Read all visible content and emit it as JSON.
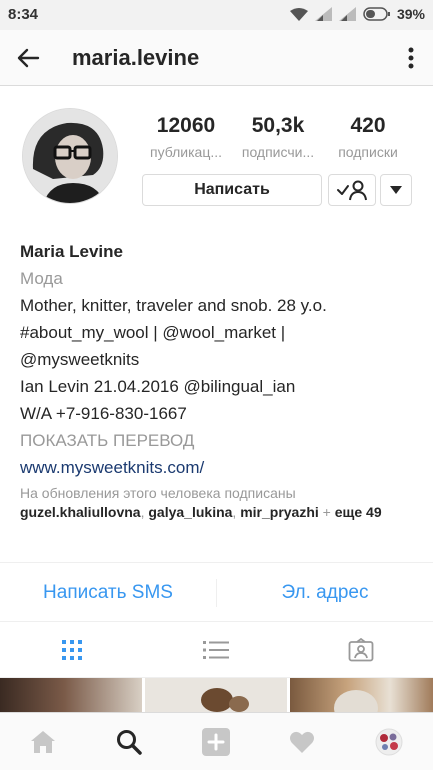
{
  "status_bar": {
    "time": "8:34",
    "battery": "39%",
    "icons": [
      "wifi-icon",
      "signal-icon",
      "signal-icon",
      "battery-icon"
    ]
  },
  "header": {
    "username": "maria.levine",
    "back_icon": "arrow-left-icon",
    "menu_icon": "more-vertical-icon"
  },
  "profile": {
    "stats": [
      {
        "value": "12060",
        "label": "публикац..."
      },
      {
        "value": "50,3k",
        "label": "подписчи..."
      },
      {
        "value": "420",
        "label": "подписки"
      }
    ],
    "message_button": "Написать",
    "follow_icon": "user-check-icon",
    "dropdown_icon": "caret-down-icon"
  },
  "bio": {
    "name": "Maria Levine",
    "category": "Мода",
    "lines": [
      "Mother, knitter, traveler and snob. 28 y.o.",
      "#about_my_wool | @wool_market |",
      "@mysweetknits",
      "Ian Levin 21.04.2016 @bilingual_ian",
      "W/A +7-916-830-1667"
    ],
    "translate": "ПОКАЗАТЬ ПЕРЕВОД",
    "website": "www.mysweetknits.com/"
  },
  "followed_by": {
    "intro": "На обновления этого человека подписаны",
    "users": [
      "guzel.khaliullovna",
      "galya_lukina",
      "mir_pryazhi"
    ],
    "separator": ", ",
    "plus": " + ",
    "more": "еще 49"
  },
  "contact": {
    "sms": "Написать SMS",
    "email": "Эл. адрес"
  },
  "tabs": [
    "grid-icon",
    "list-icon",
    "tagged-icon"
  ],
  "bottom_nav": [
    "home-icon",
    "search-icon",
    "add-icon",
    "heart-icon",
    "profile-avatar"
  ],
  "colors": {
    "accent": "#3897f0",
    "link": "#1b3a70",
    "muted": "#999999",
    "border": "#dbdbdb"
  }
}
